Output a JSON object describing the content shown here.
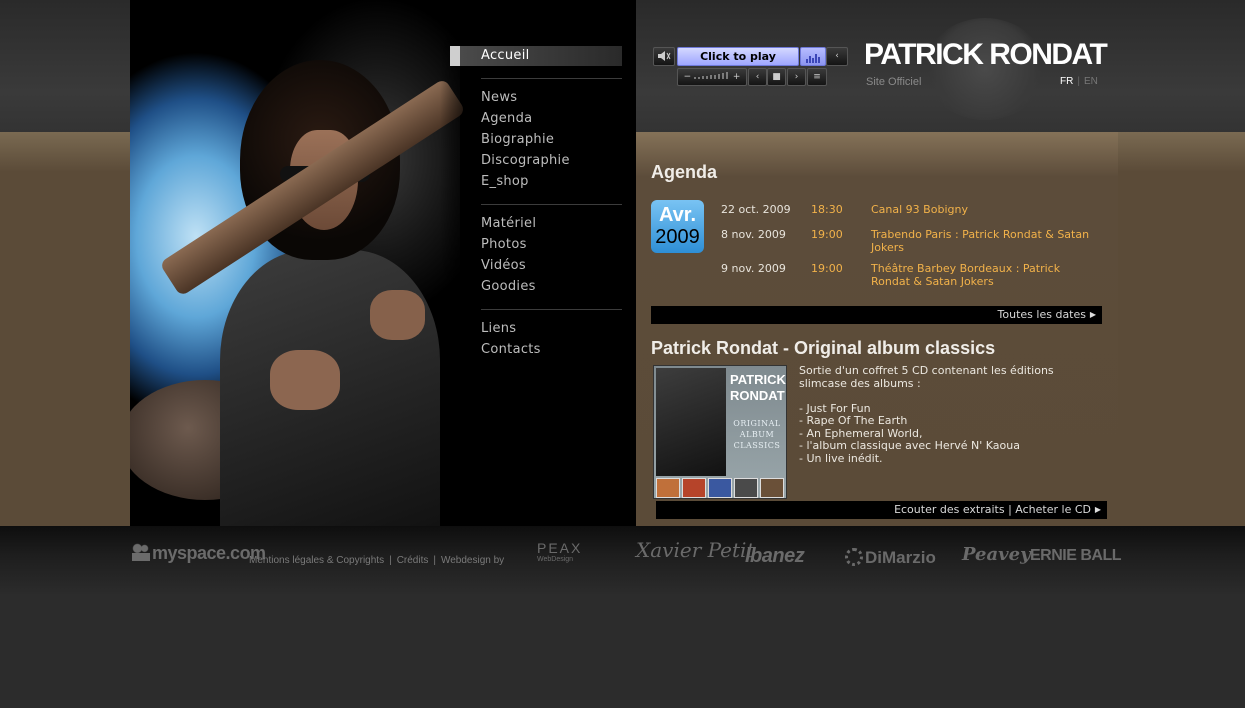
{
  "nav": {
    "items": [
      {
        "label": "Accueil"
      },
      {
        "label": "News"
      },
      {
        "label": "Agenda"
      },
      {
        "label": "Biographie"
      },
      {
        "label": "Discographie"
      },
      {
        "label": "E_shop"
      },
      {
        "label": "Matériel"
      },
      {
        "label": "Photos"
      },
      {
        "label": "Vidéos"
      },
      {
        "label": "Goodies"
      },
      {
        "label": "Liens"
      },
      {
        "label": "Contacts"
      }
    ]
  },
  "player": {
    "play_label": "Click to play",
    "mute_icon": "speaker-icon",
    "vol_minus": "−",
    "vol_plus": "+",
    "prev_icon": "‹",
    "stop_icon": "■",
    "next_icon": "›",
    "list_icon": "≡",
    "back_icon": "‹"
  },
  "header": {
    "title": "PATRICK RONDAT",
    "subtitle": "Site Officiel",
    "lang_fr": "FR",
    "lang_sep": "|",
    "lang_en": "EN"
  },
  "agenda": {
    "title": "Agenda",
    "badge_month": "Avr.",
    "badge_year": "2009",
    "events": [
      {
        "date": "22 oct. 2009",
        "time": "18:30",
        "location": "Canal 93 Bobigny"
      },
      {
        "date": "8 nov. 2009",
        "time": "19:00",
        "location": "Trabendo Paris : Patrick Rondat & Satan Jokers"
      },
      {
        "date": "9 nov. 2009",
        "time": "19:00",
        "location": "Théâtre Barbey Bordeaux : Patrick Rondat & Satan Jokers"
      }
    ],
    "all_dates_label": "Toutes les dates"
  },
  "album": {
    "title": "Patrick Rondat - Original album classics",
    "cover_title": "PATRICK RONDAT",
    "cover_subtitle": "ORIGINAL ALBUM CLASSICS",
    "text": "Sortie d'un coffret 5 CD contenant les éditions slimcase des albums :\n\n- Just For Fun\n- Rape Of The Earth\n- An Ephemeral World,\n- l'album classique avec Hervé N' Kaoua\n- Un live inédit.",
    "links_label": "Ecouter des extraits | Acheter le CD"
  },
  "footer": {
    "myspace": "myspace.com",
    "links": [
      "Mentions légales & Copyrights",
      "Crédits",
      "Webdesign by"
    ],
    "link_sep": "|",
    "peax": "PEAX",
    "peax_sub": "WebDesign",
    "sponsors": [
      "Xavier Petit",
      "Ibanez",
      "DiMarzio",
      "Peavey",
      "ERNIE BALL"
    ]
  },
  "colors": {
    "accent_orange": "#f2b24a",
    "badge_blue": "#2e8fd6",
    "content_brown": "#5b4b38"
  }
}
